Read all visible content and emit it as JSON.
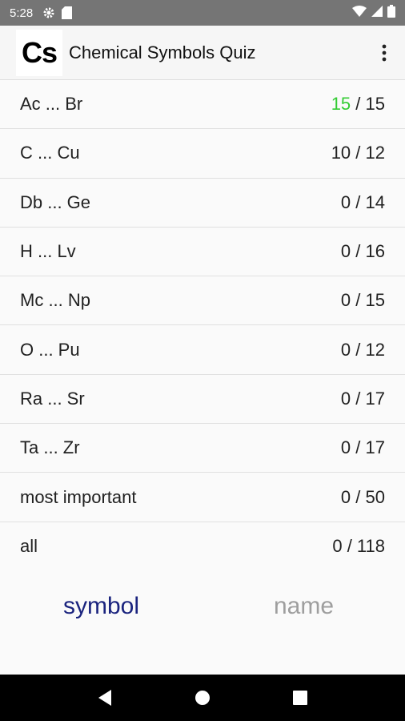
{
  "status_bar": {
    "time": "5:28",
    "icons_left": [
      "gear-icon",
      "sd-card-icon"
    ],
    "icons_right": [
      "wifi-icon",
      "signal-icon",
      "battery-icon"
    ]
  },
  "app_bar": {
    "logo_text": "Cs",
    "title": "Chemical Symbols Quiz",
    "menu_icon": "more-vert-icon"
  },
  "colors": {
    "complete": "#33cc33",
    "active_mode": "#1a237e",
    "inactive_mode": "#9e9e9e"
  },
  "lists": [
    {
      "range": "Ac ... Br",
      "done": "15",
      "total": "15",
      "complete": true
    },
    {
      "range": "C ... Cu",
      "done": "10",
      "total": "12",
      "complete": false
    },
    {
      "range": "Db ... Ge",
      "done": "0",
      "total": "14",
      "complete": false
    },
    {
      "range": "H ... Lv",
      "done": "0",
      "total": "16",
      "complete": false
    },
    {
      "range": "Mc ... Np",
      "done": "0",
      "total": "15",
      "complete": false
    },
    {
      "range": "O ... Pu",
      "done": "0",
      "total": "12",
      "complete": false
    },
    {
      "range": "Ra ... Sr",
      "done": "0",
      "total": "17",
      "complete": false
    },
    {
      "range": "Ta ... Zr",
      "done": "0",
      "total": "17",
      "complete": false
    },
    {
      "range": "most important",
      "done": "0",
      "total": "50",
      "complete": false
    },
    {
      "range": "all",
      "done": "0",
      "total": "118",
      "complete": false
    }
  ],
  "modes": {
    "symbol": "symbol",
    "name": "name",
    "selected": "symbol"
  },
  "nav": [
    "back-icon",
    "home-icon",
    "recents-icon"
  ]
}
